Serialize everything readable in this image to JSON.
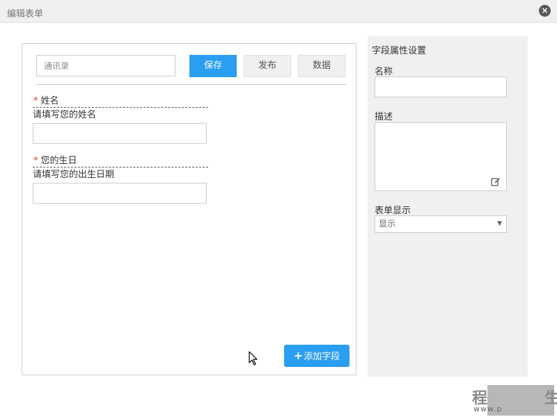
{
  "window": {
    "title": "编辑表单",
    "close_label": "×"
  },
  "toolbar": {
    "name_placeholder": "通讯录",
    "save_label": "保存",
    "publish_label": "发布",
    "data_label": "数据"
  },
  "form": {
    "required_mark": "*",
    "fields": [
      {
        "label": "姓名",
        "description": "请填写您的姓名",
        "required": true
      },
      {
        "label": "您的生日",
        "description": "请填写您的出生日期",
        "required": true
      }
    ],
    "add_field_icon": "+",
    "add_field_label": "添加字段"
  },
  "properties": {
    "title": "字段属性设置",
    "name_label": "名称",
    "description_label": "描述",
    "display_label": "表单显示",
    "display_value": "显示",
    "select_arrow": "▼"
  },
  "watermark": {
    "char_left": "程",
    "char_right": "生",
    "url": "www.p"
  },
  "colors": {
    "primary": "#2a9ef0",
    "required": "#e03030",
    "panel_bg": "#f0f0f0"
  }
}
